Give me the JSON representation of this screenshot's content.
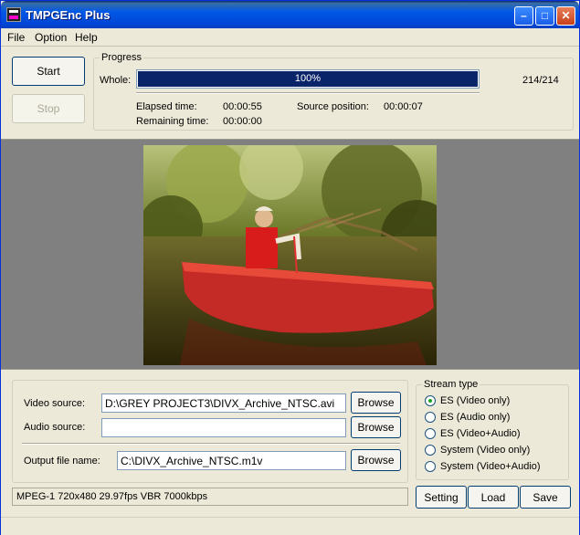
{
  "window": {
    "title": "TMPGEnc Plus"
  },
  "menu": [
    "File",
    "Option",
    "Help"
  ],
  "controls": {
    "start": "Start",
    "stop": "Stop"
  },
  "progress": {
    "group_label": "Progress",
    "whole_label": "Whole:",
    "percent_text": "100%",
    "fraction": 1.0,
    "count": "214/214",
    "elapsed_label": "Elapsed time:",
    "elapsed_value": "00:00:55",
    "remaining_label": "Remaining time:",
    "remaining_value": "00:00:00",
    "source_pos_label": "Source position:",
    "source_pos_value": "00:00:07"
  },
  "files": {
    "video_label": "Video source:",
    "video_value": "D:\\GREY PROJECT3\\DIVX_Archive_NTSC.avi",
    "audio_label": "Audio source:",
    "audio_value": "",
    "output_label": "Output file name:",
    "output_value": "C:\\DIVX_Archive_NTSC.m1v",
    "browse": "Browse"
  },
  "stream_type": {
    "label": "Stream type",
    "options": [
      {
        "label": "ES (Video only)",
        "checked": true
      },
      {
        "label": "ES (Audio only)",
        "checked": false
      },
      {
        "label": "ES (Video+Audio)",
        "checked": false
      },
      {
        "label": "System (Video only)",
        "checked": false
      },
      {
        "label": "System (Video+Audio)",
        "checked": false
      }
    ]
  },
  "status": {
    "format": "MPEG-1 720x480 29.97fps VBR 7000kbps"
  },
  "actions": {
    "setting": "Setting",
    "load": "Load",
    "save": "Save"
  },
  "colors": {
    "progress_fill": "#0a246a",
    "titlebar": "#0058e6"
  }
}
